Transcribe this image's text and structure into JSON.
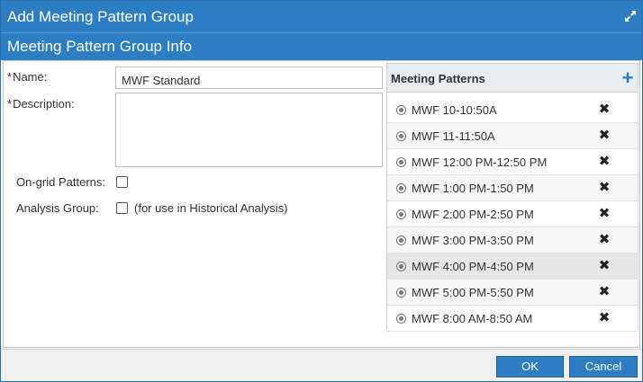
{
  "dialog": {
    "title": "Add Meeting Pattern Group",
    "section_title": "Meeting Pattern Group Info",
    "expand_icon": "expand-icon"
  },
  "form": {
    "name_label": "Name:",
    "name_required": "*",
    "name_value": "MWF Standard",
    "description_label": "Description:",
    "description_required": "*",
    "description_value": "",
    "ongrid_label": "On-grid Patterns:",
    "ongrid_checked": false,
    "analysis_label": "Analysis Group:",
    "analysis_checked": false,
    "analysis_note": "(for use in Historical Analysis)"
  },
  "meeting_patterns": {
    "title": "Meeting Patterns",
    "add_symbol": "+",
    "remove_symbol": "✖",
    "items": [
      {
        "label": "MWF 10-10:50A"
      },
      {
        "label": "MWF 11-11:50A"
      },
      {
        "label": "MWF 12:00 PM-12:50 PM"
      },
      {
        "label": "MWF 1:00 PM-1:50 PM"
      },
      {
        "label": "MWF 2:00 PM-2:50 PM"
      },
      {
        "label": "MWF 3:00 PM-3:50 PM"
      },
      {
        "label": "MWF 4:00 PM-4:50 PM"
      },
      {
        "label": "MWF 5:00 PM-5:50 PM"
      },
      {
        "label": "MWF 8:00 AM-8:50 AM"
      }
    ],
    "selected_index": 6
  },
  "footer": {
    "ok_label": "OK",
    "cancel_label": "Cancel"
  },
  "colors": {
    "accent": "#2d7dc3",
    "panel_header": "#e8edf2"
  }
}
